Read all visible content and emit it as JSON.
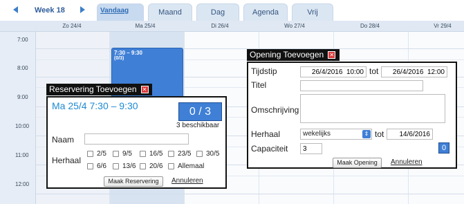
{
  "nav": {
    "week_label": "Week 18",
    "today_label": "Vandaag",
    "tabs": [
      {
        "label": "Maand"
      },
      {
        "label": "Dag"
      },
      {
        "label": "Agenda"
      },
      {
        "label": "Vrij"
      }
    ]
  },
  "calendar": {
    "days": [
      "Zo 24/4",
      "Ma 25/4",
      "Di 26/4",
      "Wo 27/4",
      "Do 28/4",
      "Vr 29/4"
    ],
    "times": [
      "7:00",
      "8:00",
      "9:00",
      "10:00",
      "11:00",
      "12:00"
    ],
    "event": {
      "time": "7:30 – 9:30",
      "count": "(0/3)"
    }
  },
  "reservation": {
    "title": "Reservering Toevoegen",
    "close_symbol": "✕",
    "date_time": "Ma 25/4  7:30 – 9:30",
    "count": "0 / 3",
    "available": "3 beschikbaar",
    "name_label": "Naam",
    "name_value": "",
    "repeat_label": "Herhaal",
    "repeat_options": [
      "2/5",
      "9/5",
      "16/5",
      "23/5",
      "30/5",
      "6/6",
      "13/6",
      "20/6",
      "Allemaal"
    ],
    "submit_label": "Maak Reservering",
    "cancel_label": "Annuleren"
  },
  "opening": {
    "title": "Opening Toevoegen",
    "close_symbol": "✕",
    "time_label": "Tijdstip",
    "from_value": "26/4/2016  10:00",
    "to_label": "tot",
    "to_value": "26/4/2016  12:00",
    "title_label": "Titel",
    "title_value": "",
    "description_label": "Omschrijving",
    "repeat_label": "Herhaal",
    "repeat_value": "wekelijks",
    "repeat_to_label": "tot",
    "repeat_until": "14/6/2016",
    "capacity_label": "Capaciteit",
    "capacity_value": "3",
    "capacity_badge": "0",
    "submit_label": "Maak Opening",
    "cancel_label": "Annuleren"
  },
  "colors": {
    "accent": "#3f7fd6",
    "date_text": "#1e8ad2",
    "close_button": "#d93b3b"
  }
}
